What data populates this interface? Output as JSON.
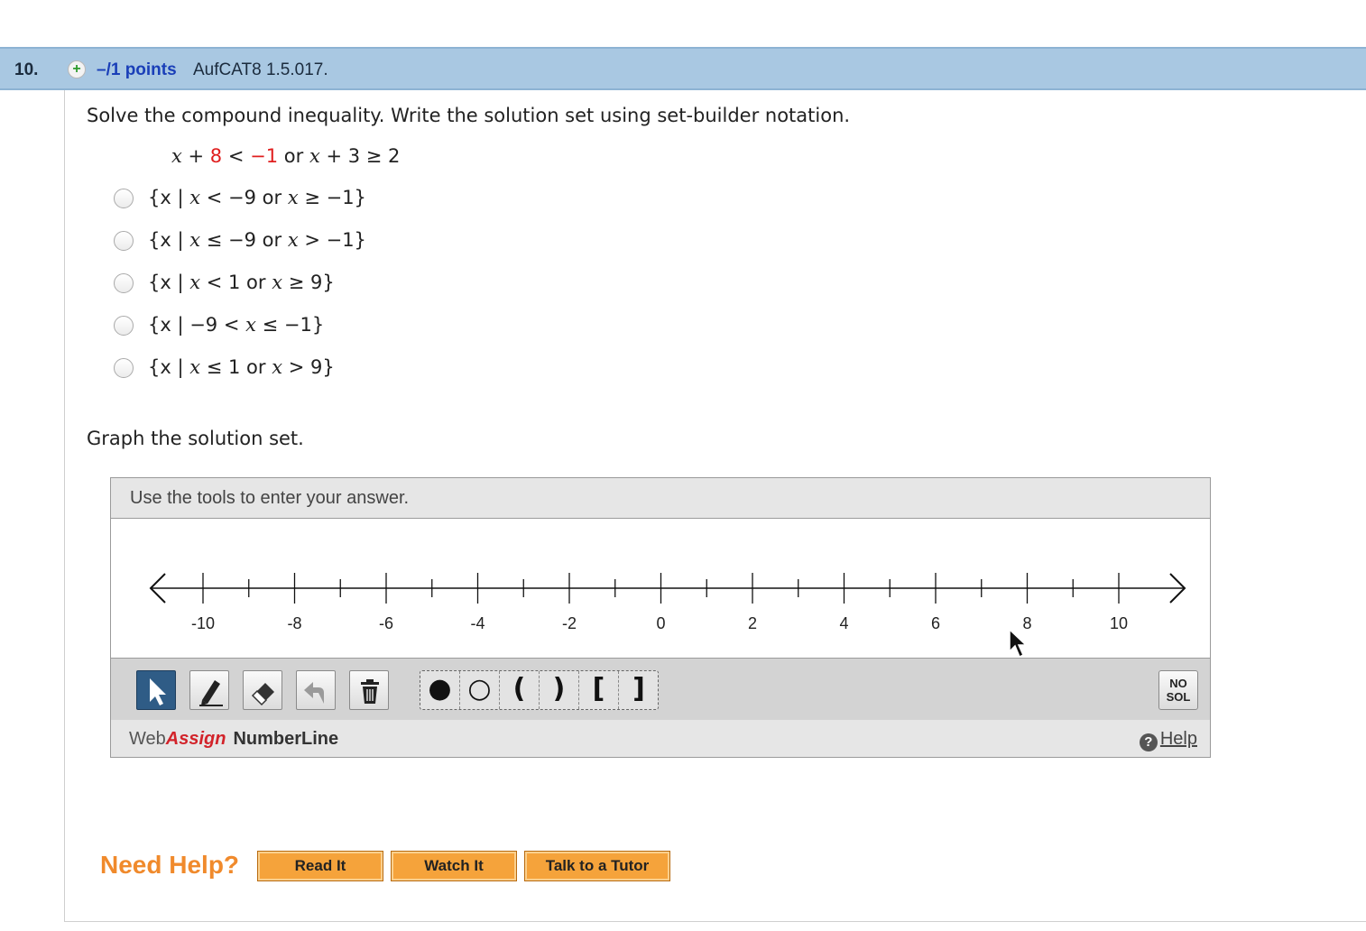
{
  "question": {
    "number": "10.",
    "points": "–/1 points",
    "code": "AufCAT8 1.5.017.",
    "prompt": "Solve the compound inequality. Write the solution set using set-builder notation.",
    "inequality": {
      "part1_var": "x",
      "part1_op": " + ",
      "part1_num": "8",
      "part1_rel": " < ",
      "part1_rhs": "−1",
      "connector": " or ",
      "part2_var": "x",
      "part2_rest": " + 3 ≥ 2"
    },
    "choices": [
      {
        "a": "{x | ",
        "v": "x",
        "b": " < −9 or ",
        "v2": "x",
        "c": " ≥ −1}"
      },
      {
        "a": "{x | ",
        "v": "x",
        "b": " ≤ −9 or ",
        "v2": "x",
        "c": " > −1}"
      },
      {
        "a": "{x | ",
        "v": "x",
        "b": " < 1 or ",
        "v2": "x",
        "c": " ≥ 9}"
      },
      {
        "a": "{x | −9 < ",
        "v": "x",
        "b": " ≤ −1}",
        "v2": "",
        "c": ""
      },
      {
        "a": "{x | ",
        "v": "x",
        "b": " ≤ 1 or ",
        "v2": "x",
        "c": " > 9}"
      }
    ],
    "graph_prompt": "Graph the solution set."
  },
  "numberline_tool": {
    "instruction": "Use the tools to enter your answer.",
    "axis": {
      "min": -10,
      "max": 10,
      "labeled_ticks": [
        "-10",
        "-8",
        "-6",
        "-4",
        "-2",
        "0",
        "2",
        "4",
        "6",
        "8",
        "10"
      ],
      "minor_step": 1
    },
    "tools": [
      "pointer-icon",
      "pencil-icon",
      "eraser-icon",
      "undo-icon",
      "trash-icon"
    ],
    "symbols": [
      "●",
      "○",
      "(",
      ")",
      "[",
      "]"
    ],
    "no_solution_line1": "NO",
    "no_solution_line2": "SOL",
    "brand_web": "Web",
    "brand_assign": "Assign",
    "brand_product": "NumberLine",
    "help_icon": "?",
    "help_label": "Help"
  },
  "help_bar": {
    "label": "Need Help?",
    "buttons": [
      "Read It",
      "Watch It",
      "Talk to a Tutor"
    ]
  },
  "colors": {
    "header": "#a9c8e2",
    "points": "#1a3fb8",
    "highlight": "#e01e1e",
    "help_button": "#f5a33b",
    "need_help": "#f08a2c"
  }
}
